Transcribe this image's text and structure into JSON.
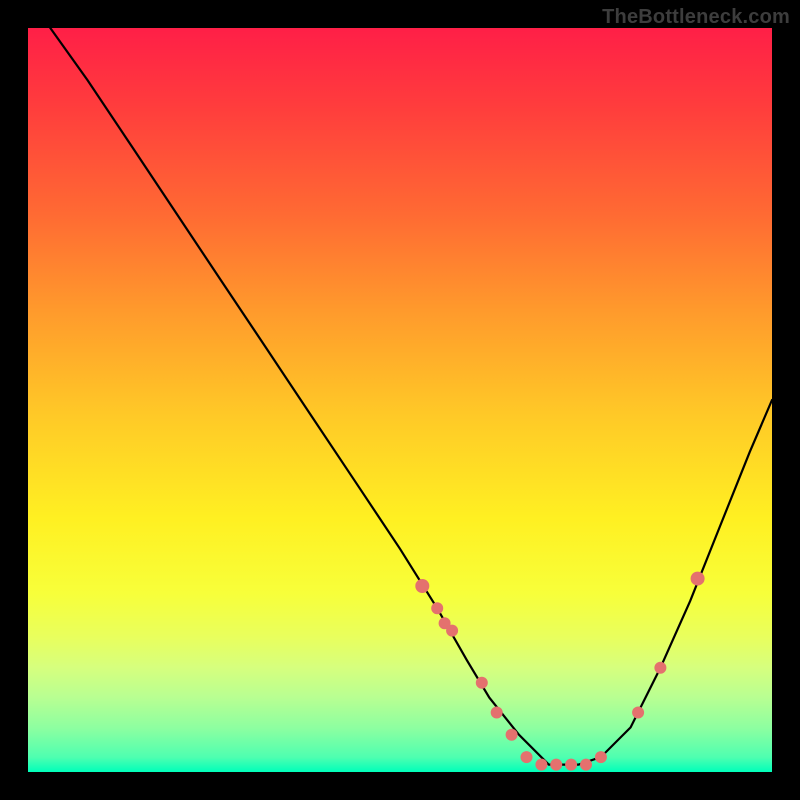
{
  "watermark": "TheBottleneck.com",
  "colors": {
    "background": "#000000",
    "curve": "#000000",
    "dots": "#e4716e",
    "gradient_top": "#ff1f47",
    "gradient_mid": "#fff022",
    "gradient_bottom": "#00ffba"
  },
  "chart_data": {
    "type": "line",
    "title": "",
    "xlabel": "",
    "ylabel": "",
    "xlim": [
      0,
      100
    ],
    "ylim": [
      0,
      100
    ],
    "series": [
      {
        "name": "bottleneck-curve",
        "x": [
          3,
          8,
          14,
          20,
          26,
          32,
          38,
          44,
          50,
          55,
          59,
          62,
          66,
          70,
          74,
          77,
          81,
          85,
          89,
          93,
          97,
          100
        ],
        "y": [
          100,
          93,
          84,
          75,
          66,
          57,
          48,
          39,
          30,
          22,
          15,
          10,
          5,
          1,
          1,
          2,
          6,
          14,
          23,
          33,
          43,
          50
        ]
      }
    ],
    "highlight_points": {
      "name": "highlighted-dots",
      "x": [
        53,
        55,
        56,
        57,
        61,
        63,
        65,
        67,
        69,
        71,
        73,
        75,
        77,
        82,
        85,
        90
      ],
      "y": [
        25,
        22,
        20,
        19,
        12,
        8,
        5,
        2,
        1,
        1,
        1,
        1,
        2,
        8,
        14,
        26
      ]
    }
  }
}
